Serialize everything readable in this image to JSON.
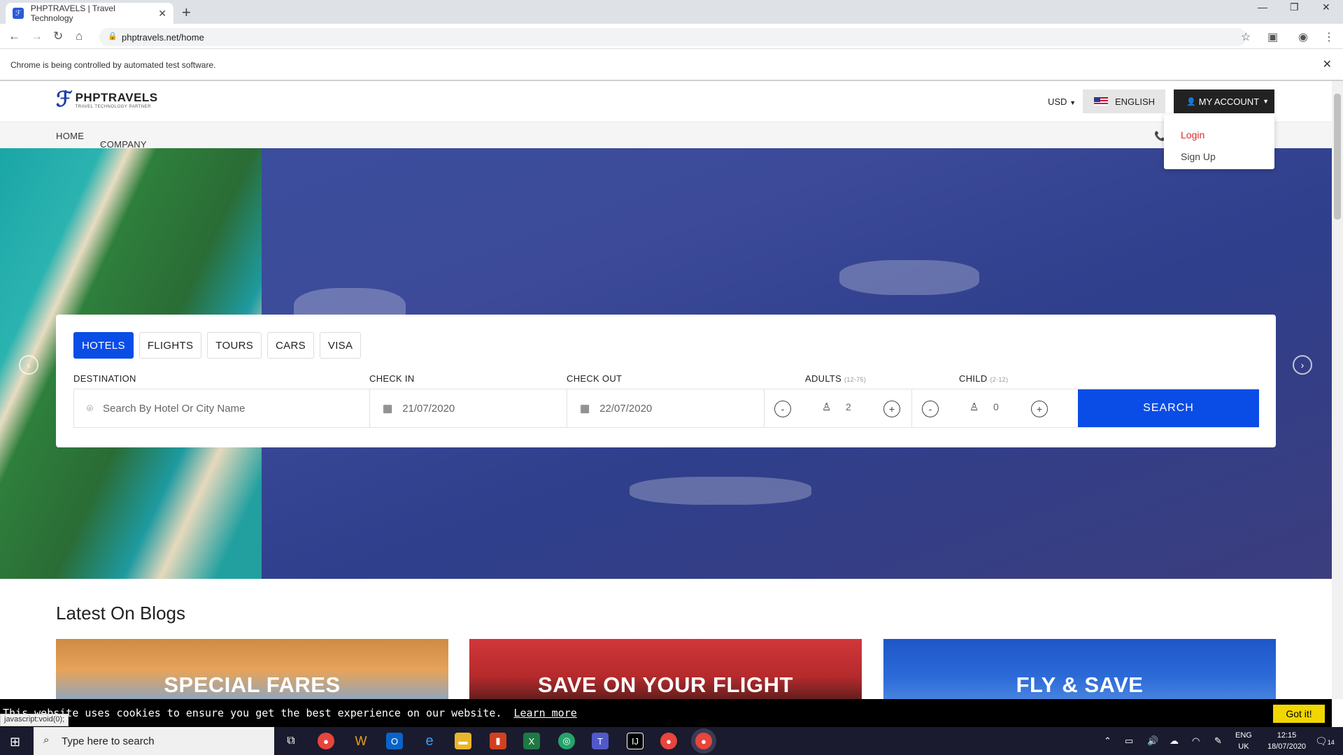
{
  "browser": {
    "tab_title": "PHPTRAVELS | Travel Technology",
    "url": "phptravels.net/home",
    "infobar_text": "Chrome is being controlled by automated test software."
  },
  "site": {
    "logo_title": "PHPTRAVELS",
    "logo_tagline": "TRAVEL TECHNOLOGY PARTNER",
    "currency": "USD",
    "language": "ENGLISH",
    "account_label": "MY ACCOUNT",
    "nav": {
      "home": "HOME",
      "company": "COMPANY"
    },
    "account_menu": {
      "login": "Login",
      "signup": "Sign Up"
    }
  },
  "search": {
    "tabs": [
      "HOTELS",
      "FLIGHTS",
      "TOURS",
      "CARS",
      "VISA"
    ],
    "active_tab": "HOTELS",
    "labels": {
      "destination": "DESTINATION",
      "checkin": "CHECK IN",
      "checkout": "CHECK OUT",
      "adults": "ADULTS",
      "adults_range": "(12-75)",
      "child": "CHILD",
      "child_range": "(2-12)"
    },
    "destination_placeholder": "Search By Hotel Or City Name",
    "checkin_value": "21/07/2020",
    "checkout_value": "22/07/2020",
    "adults_value": "2",
    "child_value": "0",
    "button_label": "SEARCH"
  },
  "blogs": {
    "title": "Latest On Blogs",
    "cards": [
      "SPECIAL FARES",
      "SAVE ON YOUR FLIGHT",
      "FLY & SAVE"
    ]
  },
  "cookie": {
    "text": "This website uses cookies to ensure you get the best experience on our website.",
    "learn_more": "Learn more",
    "button": "Got it!"
  },
  "status_bar": "javascript:void(0);",
  "taskbar": {
    "search_placeholder": "Type here to search",
    "lang": "ENG",
    "region": "UK",
    "time": "12:15",
    "date": "18/07/2020",
    "notifications": "14"
  },
  "colors": {
    "accent": "#0a4de6",
    "account_bg": "#222222",
    "login_red": "#e0262a",
    "cookie_btn": "#f1d600"
  }
}
